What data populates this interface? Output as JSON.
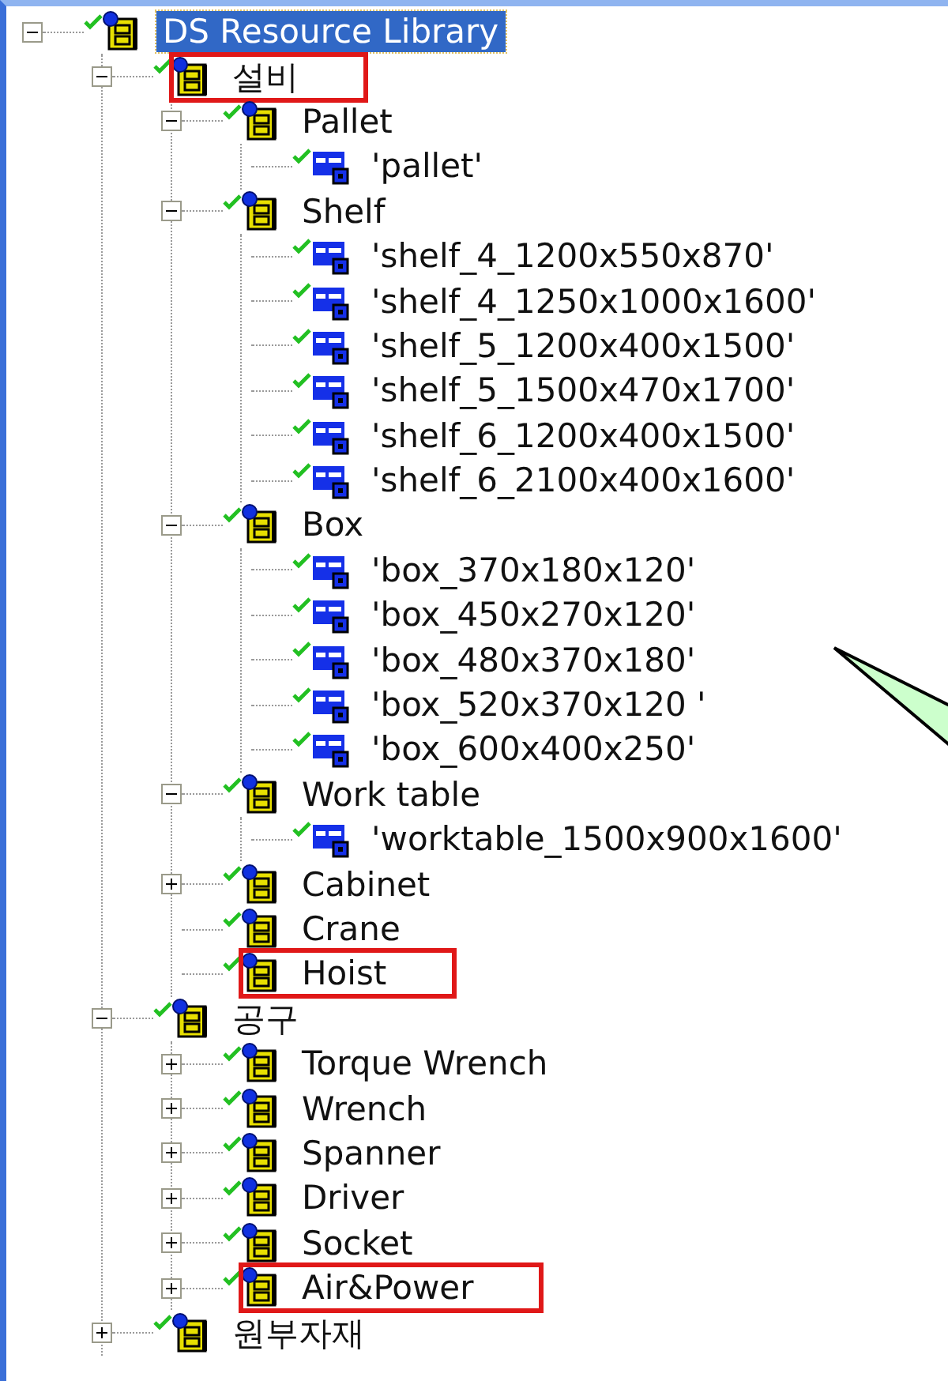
{
  "tree": {
    "label": "DS Resource Library",
    "kind": "group",
    "selected": true,
    "highlighted": false,
    "expanded": true,
    "children": [
      {
        "label": "설비",
        "kind": "group",
        "selected": false,
        "highlighted": true,
        "expanded": true,
        "children": [
          {
            "label": "Pallet",
            "kind": "group",
            "selected": false,
            "highlighted": false,
            "expanded": true,
            "children": [
              {
                "label": "'pallet'",
                "kind": "item",
                "selected": false,
                "highlighted": false
              }
            ]
          },
          {
            "label": "Shelf",
            "kind": "group",
            "selected": false,
            "highlighted": false,
            "expanded": true,
            "children": [
              {
                "label": "'shelf_4_1200x550x870'",
                "kind": "item",
                "selected": false,
                "highlighted": false
              },
              {
                "label": "'shelf_4_1250x1000x1600'",
                "kind": "item",
                "selected": false,
                "highlighted": false
              },
              {
                "label": "'shelf_5_1200x400x1500'",
                "kind": "item",
                "selected": false,
                "highlighted": false
              },
              {
                "label": "'shelf_5_1500x470x1700'",
                "kind": "item",
                "selected": false,
                "highlighted": false
              },
              {
                "label": "'shelf_6_1200x400x1500'",
                "kind": "item",
                "selected": false,
                "highlighted": false
              },
              {
                "label": "'shelf_6_2100x400x1600'",
                "kind": "item",
                "selected": false,
                "highlighted": false
              }
            ]
          },
          {
            "label": "Box",
            "kind": "group",
            "selected": false,
            "highlighted": false,
            "expanded": true,
            "children": [
              {
                "label": "'box_370x180x120'",
                "kind": "item",
                "selected": false,
                "highlighted": false
              },
              {
                "label": "'box_450x270x120'",
                "kind": "item",
                "selected": false,
                "highlighted": false
              },
              {
                "label": "'box_480x370x180'",
                "kind": "item",
                "selected": false,
                "highlighted": false
              },
              {
                "label": "'box_520x370x120 '",
                "kind": "item",
                "selected": false,
                "highlighted": false
              },
              {
                "label": "'box_600x400x250'",
                "kind": "item",
                "selected": false,
                "highlighted": false
              }
            ]
          },
          {
            "label": "Work table",
            "kind": "group",
            "selected": false,
            "highlighted": false,
            "expanded": true,
            "children": [
              {
                "label": "'worktable_1500x900x1600'",
                "kind": "item",
                "selected": false,
                "highlighted": false
              }
            ]
          },
          {
            "label": "Cabinet",
            "kind": "group",
            "selected": false,
            "highlighted": false,
            "expanded": false
          },
          {
            "label": "Crane",
            "kind": "group",
            "selected": false,
            "highlighted": false
          },
          {
            "label": "Hoist",
            "kind": "group",
            "selected": false,
            "highlighted": true
          }
        ]
      },
      {
        "label": "공구",
        "kind": "group",
        "selected": false,
        "highlighted": false,
        "expanded": true,
        "children": [
          {
            "label": "Torque Wrench",
            "kind": "group",
            "selected": false,
            "highlighted": false,
            "expanded": false
          },
          {
            "label": "Wrench",
            "kind": "group",
            "selected": false,
            "highlighted": false,
            "expanded": false
          },
          {
            "label": "Spanner",
            "kind": "group",
            "selected": false,
            "highlighted": false,
            "expanded": false
          },
          {
            "label": "Driver",
            "kind": "group",
            "selected": false,
            "highlighted": false,
            "expanded": false
          },
          {
            "label": "Socket",
            "kind": "group",
            "selected": false,
            "highlighted": false,
            "expanded": false
          },
          {
            "label": "Air&Power",
            "kind": "group",
            "selected": false,
            "highlighted": true,
            "expanded": false
          }
        ]
      },
      {
        "label": "원부자재",
        "kind": "group",
        "selected": false,
        "highlighted": false,
        "expanded": false
      }
    ]
  }
}
